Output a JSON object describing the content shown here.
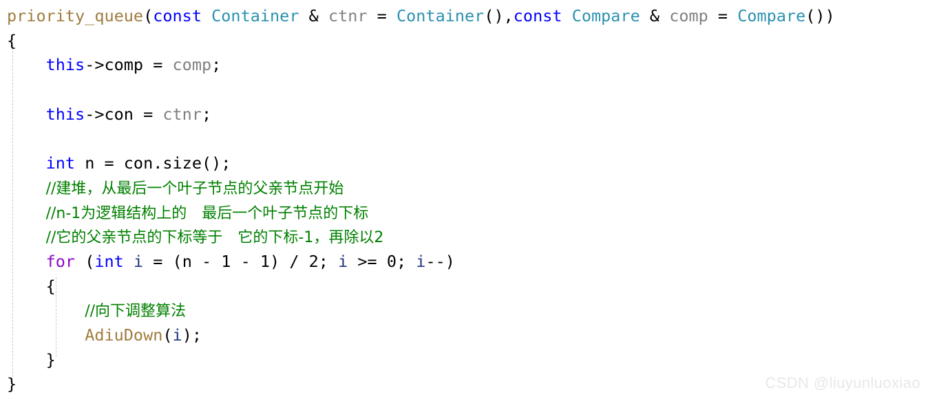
{
  "editor": {
    "language": "cpp",
    "background_color": "#ffffff",
    "indent_guide_color": "#c8c8c8"
  },
  "colors": {
    "plain": "#000000",
    "keyword": "#0000ff",
    "control_keyword": "#8f08c4",
    "type": "#2b91af",
    "function": "#a07c3f",
    "parameter": "#808080",
    "local_variable": "#1f377f",
    "comment": "#008000",
    "watermark": "#e8e8e8"
  },
  "watermark": {
    "text": "CSDN @liuyunluoxiao"
  },
  "code": {
    "lines": [
      {
        "id": "line-1-signature",
        "segments": [
          {
            "text": "priority_queue",
            "kind": "func"
          },
          {
            "text": "(",
            "kind": "plain"
          },
          {
            "text": "const",
            "kind": "keyword"
          },
          {
            "text": " ",
            "kind": "plain"
          },
          {
            "text": "Container",
            "kind": "type"
          },
          {
            "text": " & ",
            "kind": "plain"
          },
          {
            "text": "ctnr",
            "kind": "param"
          },
          {
            "text": " = ",
            "kind": "plain"
          },
          {
            "text": "Container",
            "kind": "type"
          },
          {
            "text": "(),",
            "kind": "plain"
          },
          {
            "text": "const",
            "kind": "keyword"
          },
          {
            "text": " ",
            "kind": "plain"
          },
          {
            "text": "Compare",
            "kind": "type"
          },
          {
            "text": " & ",
            "kind": "plain"
          },
          {
            "text": "comp",
            "kind": "param"
          },
          {
            "text": " = ",
            "kind": "plain"
          },
          {
            "text": "Compare",
            "kind": "type"
          },
          {
            "text": "())",
            "kind": "plain"
          }
        ]
      },
      {
        "id": "line-2-open-brace",
        "segments": [
          {
            "text": "{",
            "kind": "plain"
          }
        ]
      },
      {
        "id": "line-3-assign-comp",
        "segments": [
          {
            "text": "    ",
            "kind": "plain"
          },
          {
            "text": "this",
            "kind": "keyword"
          },
          {
            "text": "->comp = ",
            "kind": "plain"
          },
          {
            "text": "comp",
            "kind": "param"
          },
          {
            "text": ";",
            "kind": "plain"
          }
        ]
      },
      {
        "id": "line-4-blank",
        "segments": [
          {
            "text": " ",
            "kind": "plain"
          }
        ]
      },
      {
        "id": "line-5-assign-con",
        "segments": [
          {
            "text": "    ",
            "kind": "plain"
          },
          {
            "text": "this",
            "kind": "keyword"
          },
          {
            "text": "->con = ",
            "kind": "plain"
          },
          {
            "text": "ctnr",
            "kind": "param"
          },
          {
            "text": ";",
            "kind": "plain"
          }
        ]
      },
      {
        "id": "line-6-blank",
        "segments": [
          {
            "text": " ",
            "kind": "plain"
          }
        ]
      },
      {
        "id": "line-7-int-n",
        "segments": [
          {
            "text": "    ",
            "kind": "plain"
          },
          {
            "text": "int",
            "kind": "keyword"
          },
          {
            "text": " n = con.size();",
            "kind": "plain"
          }
        ]
      },
      {
        "id": "line-8-comment-build-heap",
        "segments": [
          {
            "text": "    ",
            "kind": "plain"
          },
          {
            "text": "//建堆，从最后一个叶子节点的父亲节点开始",
            "kind": "comment"
          }
        ]
      },
      {
        "id": "line-9-comment-last-leaf-index",
        "segments": [
          {
            "text": "    ",
            "kind": "plain"
          },
          {
            "text": "//n-1为逻辑结构上的　最后一个叶子节点的下标",
            "kind": "comment"
          }
        ]
      },
      {
        "id": "line-10-comment-parent-index",
        "segments": [
          {
            "text": "    ",
            "kind": "plain"
          },
          {
            "text": "//它的父亲节点的下标等于　它的下标-1，再除以2",
            "kind": "comment"
          }
        ]
      },
      {
        "id": "line-11-for-loop",
        "segments": [
          {
            "text": "    ",
            "kind": "plain"
          },
          {
            "text": "for",
            "kind": "control"
          },
          {
            "text": " (",
            "kind": "plain"
          },
          {
            "text": "int",
            "kind": "keyword"
          },
          {
            "text": " ",
            "kind": "plain"
          },
          {
            "text": "i",
            "kind": "local"
          },
          {
            "text": " = (n - 1 - 1) / 2; ",
            "kind": "plain"
          },
          {
            "text": "i",
            "kind": "local"
          },
          {
            "text": " >= 0; ",
            "kind": "plain"
          },
          {
            "text": "i",
            "kind": "local"
          },
          {
            "text": "--)",
            "kind": "plain"
          }
        ]
      },
      {
        "id": "line-12-inner-open-brace",
        "segments": [
          {
            "text": "    {",
            "kind": "plain"
          }
        ]
      },
      {
        "id": "line-13-comment-adjust-down",
        "segments": [
          {
            "text": "        ",
            "kind": "plain"
          },
          {
            "text": "//向下调整算法",
            "kind": "comment"
          }
        ]
      },
      {
        "id": "line-14-call-adiudown",
        "segments": [
          {
            "text": "        ",
            "kind": "plain"
          },
          {
            "text": "AdiuDown",
            "kind": "func"
          },
          {
            "text": "(",
            "kind": "plain"
          },
          {
            "text": "i",
            "kind": "local"
          },
          {
            "text": ");",
            "kind": "plain"
          }
        ]
      },
      {
        "id": "line-15-inner-close-brace",
        "segments": [
          {
            "text": "    }",
            "kind": "plain"
          }
        ]
      },
      {
        "id": "line-16-close-brace",
        "segments": [
          {
            "text": "}",
            "kind": "plain"
          }
        ]
      }
    ]
  }
}
